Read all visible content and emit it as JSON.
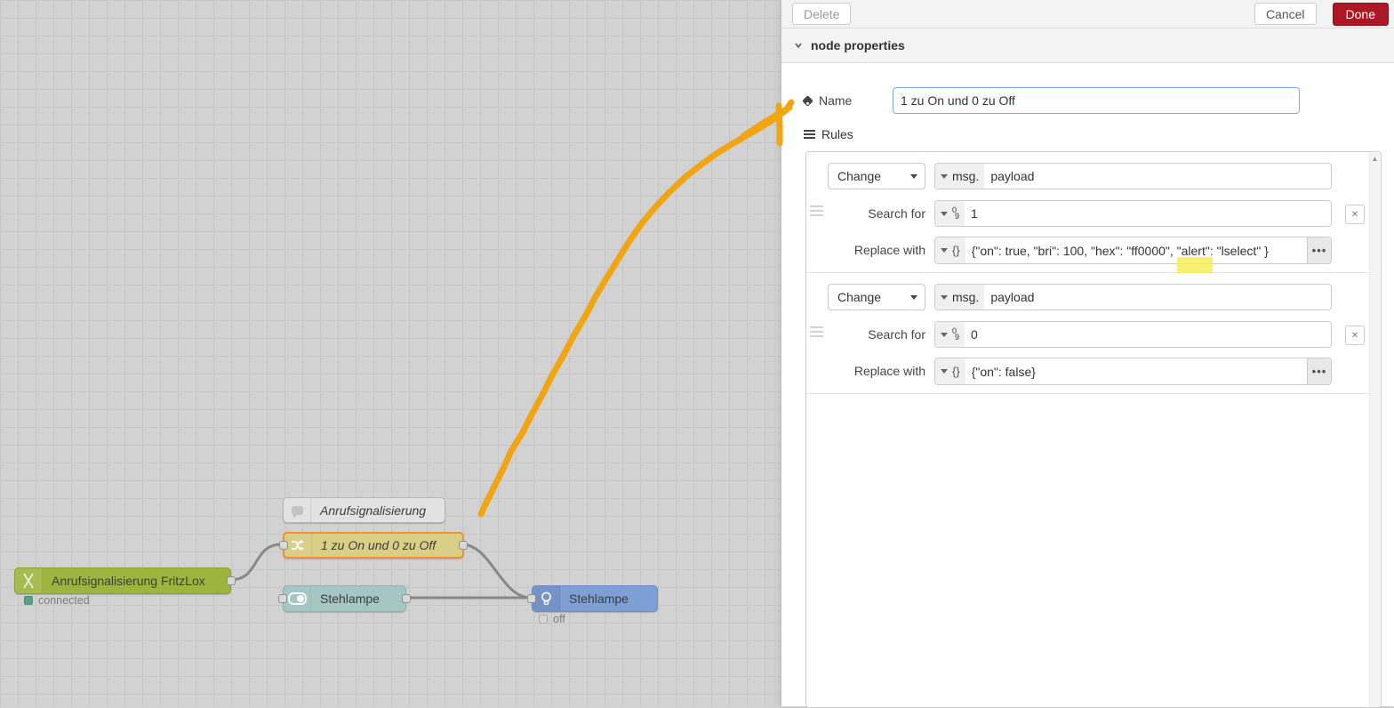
{
  "colors": {
    "done_button": "#AD1625",
    "selection_orange": "#ec9433",
    "annotation_arrow": "#f2a512",
    "highlight_yellow": "#f6ee4b",
    "wire_gray": "#888888",
    "name_focus_border": "#79aede"
  },
  "canvas": {
    "nodes": [
      {
        "id": "comment",
        "label": "Anrufsignalisierung"
      },
      {
        "id": "change",
        "label": "1 zu On und 0 zu Off"
      },
      {
        "id": "fritzbox",
        "label": "Anrufsignalisierung FritzLox",
        "status": "connected"
      },
      {
        "id": "switch",
        "label": "Stehlampe"
      },
      {
        "id": "light",
        "label": "Stehlampe",
        "status": "off"
      }
    ]
  },
  "panel": {
    "toolbar": {
      "delete_label": "Delete",
      "cancel_label": "Cancel",
      "done_label": "Done"
    },
    "section_title": "node properties",
    "name_label": "Name",
    "name_value": "1 zu On und 0 zu Off",
    "rules_label": "Rules",
    "icons": {
      "remove": "✕",
      "expand": "•••",
      "scroll_up": "▲"
    },
    "rules": [
      {
        "action": "Change",
        "property_prefix": "msg.",
        "property_value": "payload",
        "search_label": "Search for",
        "search_type_sup": "0",
        "search_type_sub": "9",
        "search_value": "1",
        "replace_label": "Replace with",
        "replace_type_icon": "{}",
        "replace_value": "{\"on\": true, \"bri\": 100, \"hex\": \"ff0000\", \"alert\": \"lselect\" }"
      },
      {
        "action": "Change",
        "property_prefix": "msg.",
        "property_value": "payload",
        "search_label": "Search for",
        "search_type_sup": "0",
        "search_type_sub": "9",
        "search_value": "0",
        "replace_label": "Replace with",
        "replace_type_icon": "{}",
        "replace_value": "{\"on\": false}"
      }
    ]
  }
}
